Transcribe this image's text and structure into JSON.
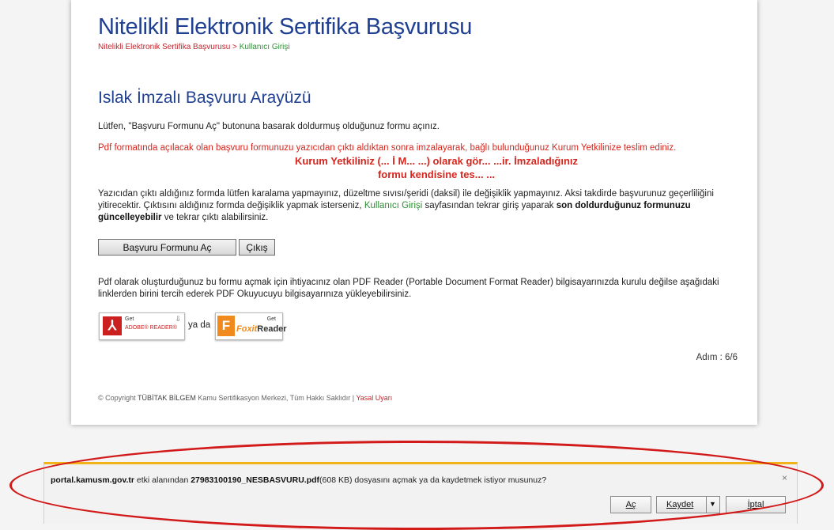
{
  "page": {
    "title": "Nitelikli Elektronik Sertifika Başvurusu",
    "breadcrumb": {
      "first": "Nitelikli Elektronik Sertifika Başvurusu",
      "separator": " > ",
      "second": "Kullanıcı Girişi"
    },
    "heading": "Islak İmzalı Başvuru Arayüzü",
    "intro": "Lütfen, \"Başvuru Formunu Aç\" butonuna basarak doldurmuş olduğunuz formu açınız.",
    "red_notice": "Pdf formatında açılacak olan başvuru formunuzu yazıcıdan çıktı aldıktan sonra imzalayarak, bağlı bulunduğunuz Kurum Yetkilinize teslim ediniz.",
    "warning_line1": "Kurum Yetkiliniz (... İ M... ...) olarak gör... ...ir. İmzaladığınız",
    "warning_line2": "formu kendisine tes... ...",
    "print_note_1": "Yazıcıdan çıktı aldığınız formda lütfen karalama yapmayınız, düzeltme sıvısı/şeridi (daksil) ile değişiklik yapmayınız. Aksi takdirde başvurunuz geçerliliğini yitirecektir. Çıktısını aldığınız formda değişiklik yapmak isterseniz, ",
    "print_note_link": "Kullanıcı Girişi",
    "print_note_2": " sayfasından tekrar giriş yaparak ",
    "print_note_bold": "son doldurduğunuz formunuzu güncelleyebilir",
    "print_note_3": " ve tekrar çıktı alabilirsiniz.",
    "open_form_button": "Başvuru Formunu Aç",
    "exit_button": "Çıkış",
    "pdf_note": "Pdf olarak oluşturduğunuz bu formu açmak için ihtiyacınız olan PDF Reader (Portable Document Format Reader) bilgisayarınızda kurulu değilse aşağıdaki linklerden birini tercih ederek PDF Okuyucuyu bilgisayarınıza yükleyebilirsiniz.",
    "adobe_get": "Get",
    "adobe_name": "ADOBE® READER®",
    "or_text": "ya da",
    "foxit_get": "Get",
    "foxit_name_1": "Foxit",
    "foxit_name_2": "Reader",
    "step": "Adım : 6/6",
    "copyright_prefix": "© Copyright ",
    "copyright_org": "TÜBİTAK BİLGEM",
    "copyright_rest": " Kamu Sertifikasyon Merkezi, Tüm Hakkı Saklıdır | ",
    "legal_link": "Yasal Uyarı"
  },
  "download_bar": {
    "site": "portal.kamusm.gov.tr",
    "text_1": " etki alanından ",
    "filename": "27983100190_NESBASVURU.pdf",
    "size": "(608 KB)",
    "text_2": " dosyasını açmak ya da kaydetmek istiyor musunuz?",
    "close": "×",
    "open_button": "Aç",
    "save_button": "Kaydet",
    "save_arrow": "▼",
    "cancel_button": "İptal"
  },
  "colors": {
    "title_blue": "#1f3f91",
    "breadcrumb_red": "#c0262d",
    "link_green": "#2f8e36",
    "notice_red": "#d7261e",
    "download_bar_accent": "#f2b318",
    "annotation_red": "#d21a1a"
  }
}
